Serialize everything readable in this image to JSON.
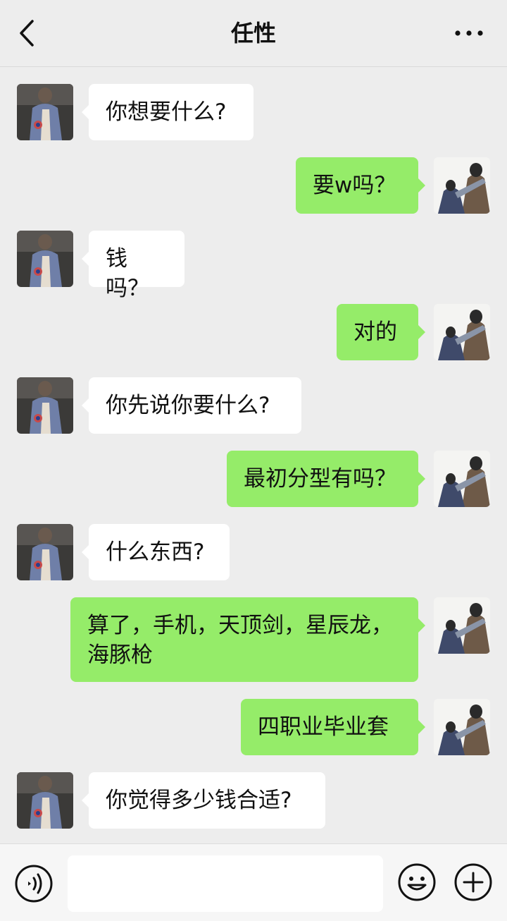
{
  "header": {
    "title": "任性",
    "back_icon": "chevron-left-icon",
    "more_icon": "more-dots-icon"
  },
  "messages": [
    {
      "side": "left",
      "text": "你想要什么?"
    },
    {
      "side": "right",
      "text": "要w吗？"
    },
    {
      "side": "left",
      "text": "钱吗？"
    },
    {
      "side": "right",
      "text": "对的"
    },
    {
      "side": "left",
      "text": "你先说你要什么?"
    },
    {
      "side": "right",
      "text": "最初分型有吗？"
    },
    {
      "side": "left",
      "text": "什么东西?"
    },
    {
      "side": "right",
      "text": "算了，手机，天顶剑，星辰龙，\n海豚枪"
    },
    {
      "side": "right",
      "text": "四职业毕业套"
    },
    {
      "side": "left",
      "text": "你觉得多少钱合适?"
    }
  ],
  "input_bar": {
    "placeholder": "",
    "value": "",
    "voice_icon": "voice-icon",
    "emoji_icon": "emoji-icon",
    "plus_icon": "plus-icon"
  },
  "colors": {
    "background": "#ededed",
    "incoming_bubble": "#ffffff",
    "outgoing_bubble": "#95ec69"
  }
}
